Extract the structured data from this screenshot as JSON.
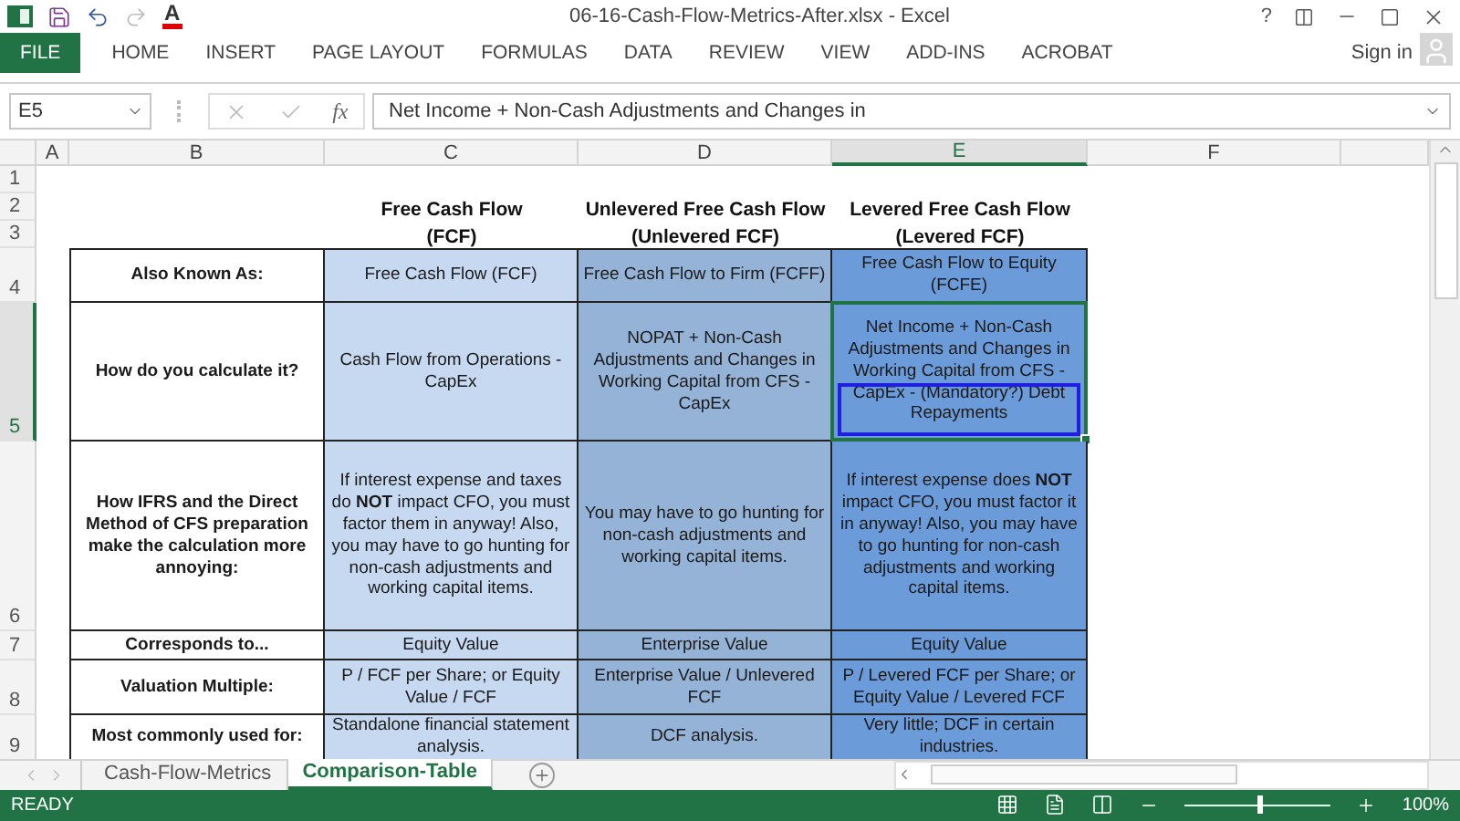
{
  "window": {
    "title": "06-16-Cash-Flow-Metrics-After.xlsx - Excel",
    "help": "?"
  },
  "quick_access": {
    "font_color": "A"
  },
  "ribbon": {
    "tabs": [
      {
        "label": "FILE",
        "kind": "file",
        "selected": false
      },
      {
        "label": "HOME",
        "kind": "tab",
        "selected": false
      },
      {
        "label": "INSERT",
        "kind": "tab",
        "selected": false
      },
      {
        "label": "PAGE LAYOUT",
        "kind": "tab",
        "selected": false
      },
      {
        "label": "FORMULAS",
        "kind": "tab",
        "selected": false
      },
      {
        "label": "DATA",
        "kind": "tab",
        "selected": false
      },
      {
        "label": "REVIEW",
        "kind": "tab",
        "selected": false
      },
      {
        "label": "VIEW",
        "kind": "tab",
        "selected": false
      },
      {
        "label": "ADD-INS",
        "kind": "tab",
        "selected": false
      },
      {
        "label": "ACROBAT",
        "kind": "tab",
        "selected": false
      }
    ],
    "account": "Sign in"
  },
  "formula_bar": {
    "name_box": "E5",
    "function_label": "fx",
    "formula": "Net Income + Non-Cash Adjustments and Changes in"
  },
  "sheet": {
    "columns": [
      {
        "label": "A",
        "selected": false
      },
      {
        "label": "B",
        "selected": false
      },
      {
        "label": "C",
        "selected": false
      },
      {
        "label": "D",
        "selected": false
      },
      {
        "label": "E",
        "selected": true
      },
      {
        "label": "F",
        "selected": false
      }
    ],
    "rows": [
      {
        "label": "1",
        "selected": false
      },
      {
        "label": "2",
        "selected": false
      },
      {
        "label": "3",
        "selected": false
      },
      {
        "label": "4",
        "selected": false
      },
      {
        "label": "5",
        "selected": true
      },
      {
        "label": "6",
        "selected": false
      },
      {
        "label": "7",
        "selected": false
      },
      {
        "label": "8",
        "selected": false
      },
      {
        "label": "9",
        "selected": false
      }
    ]
  },
  "table": {
    "columns": [
      {
        "title": "Free Cash Flow",
        "subtitle": "(FCF)",
        "color": "#c6d9f1"
      },
      {
        "title": "Unlevered Free Cash Flow",
        "subtitle": "(Unlevered FCF)",
        "color": "#95b3d7"
      },
      {
        "title": "Levered Free Cash Flow",
        "subtitle": "(Levered FCF)",
        "color": "#6b9bd8"
      }
    ],
    "rows": [
      {
        "label": "Also Known As:",
        "cells": [
          {
            "text": "Free Cash Flow (FCF)",
            "selected": false
          },
          {
            "text": "Free Cash Flow to Firm (FCFF)",
            "selected": false
          },
          {
            "text": "Free Cash Flow to Equity (FCFE)",
            "selected": false
          }
        ]
      },
      {
        "label": "How do you calculate it?",
        "cells": [
          {
            "text": "Cash Flow from Operations - CapEx",
            "selected": false
          },
          {
            "text": "NOPAT + Non-Cash Adjustments and Changes in Working Capital from CFS  - CapEx",
            "selected": false
          },
          {
            "text": "Net Income + Non-Cash Adjustments and Changes in Working Capital from CFS  - CapEx - (Mandatory?) Debt Repayments",
            "selected": true
          }
        ]
      },
      {
        "label": "How IFRS and the Direct Method of CFS preparation make the calculation more annoying:",
        "cells": [
          {
            "text": "If interest expense and taxes do **NOT** impact CFO, you must factor them in anyway! Also, you may have to go hunting for non-cash adjustments and working capital items.",
            "selected": false
          },
          {
            "text": "You may have to go hunting for non-cash adjustments and working capital items.",
            "selected": false
          },
          {
            "text": "If interest expense does **NOT** impact CFO, you must factor it in anyway! Also, you may have to go hunting for non-cash adjustments and working capital items.",
            "selected": false
          }
        ]
      },
      {
        "label": "Corresponds to...",
        "cells": [
          {
            "text": "Equity Value",
            "selected": false
          },
          {
            "text": "Enterprise Value",
            "selected": false
          },
          {
            "text": "Equity Value",
            "selected": false
          }
        ]
      },
      {
        "label": "Valuation Multiple:",
        "cells": [
          {
            "text": "P / FCF per Share; or Equity Value / FCF",
            "selected": false
          },
          {
            "text": "Enterprise Value / Unlevered FCF",
            "selected": false
          },
          {
            "text": "P / Levered FCF per Share; or Equity Value / Levered FCF",
            "selected": false
          }
        ]
      },
      {
        "label": "Most commonly used for:",
        "cells": [
          {
            "text": "Standalone financial statement analysis.",
            "selected": false
          },
          {
            "text": "DCF analysis.",
            "selected": false
          },
          {
            "text": "Very little; DCF in certain industries.",
            "selected": false
          }
        ]
      }
    ]
  },
  "sheet_tabs": [
    {
      "label": "Cash-Flow-Metrics",
      "selected": false
    },
    {
      "label": "Comparison-Table",
      "selected": true
    }
  ],
  "status_bar": {
    "status": "READY",
    "zoom": "100%",
    "zoom_level": {
      "level": 0.5
    }
  }
}
